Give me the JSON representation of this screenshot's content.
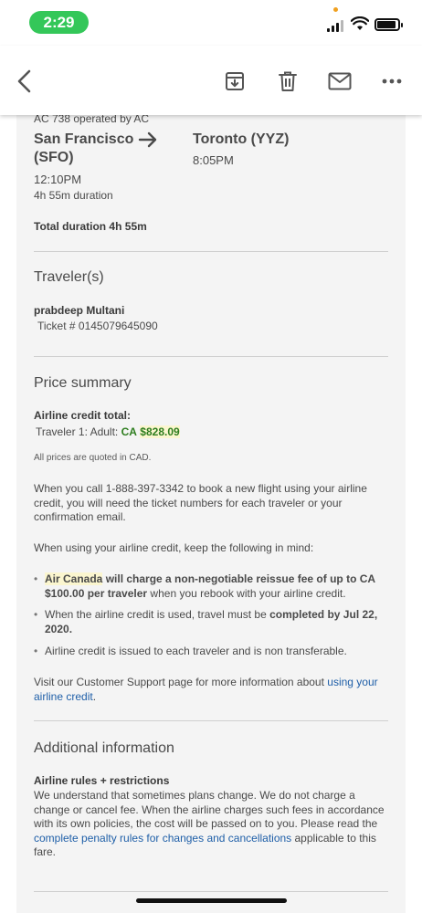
{
  "status": {
    "time": "2:29"
  },
  "toolbar": {
    "back_icon": "chevron-left-icon",
    "archive_icon": "archive-icon",
    "trash_icon": "trash-icon",
    "mail_icon": "mail-icon",
    "more_icon": "more-icon"
  },
  "flight": {
    "operated_by": "AC 738 operated by AC",
    "origin_line1": "San Francisco",
    "origin_line2": "(SFO)",
    "destination": "Toronto (YYZ)",
    "depart_time": "12:10PM",
    "arrive_time": "8:05PM",
    "duration": "4h 55m duration",
    "total_duration": "Total duration 4h 55m"
  },
  "traveler": {
    "section_title": "Traveler(s)",
    "name": "prabdeep Multani",
    "ticket": "Ticket # 0145079645090"
  },
  "price": {
    "section_title": "Price summary",
    "credit_total_label": "Airline credit total:",
    "traveler_line_prefix": "Traveler 1: Adult:",
    "currency": "CA",
    "amount": "$828.09",
    "note": "All prices are quoted in CAD.",
    "call_info": "When you call 1-888-397-3342 to book a new flight using your airline credit, you will need the ticket numbers for each traveler or your confirmation email.",
    "keep_in_mind": "When using your airline credit, keep the following in mind:",
    "bullet1_airline": "Air Canada",
    "bullet1_bold": " will charge a non-negotiable reissue fee of up to CA $100.00 per traveler",
    "bullet1_rest": " when you rebook with your airline credit.",
    "bullet2_prefix": "When the airline credit is used, travel must be ",
    "bullet2_bold": "completed by Jul 22, 2020.",
    "bullet3": "Airline credit is issued to each traveler and is non transferable.",
    "support_prefix": "Visit our Customer Support page for more information about ",
    "support_link": "using your airline credit",
    "support_suffix": "."
  },
  "additional": {
    "section_title": "Additional information",
    "rules_title": "Airline rules + restrictions",
    "rules_text": "We understand that sometimes plans change. We do not charge a change or cancel fee. When the airline charges such fees in accordance with its own policies, the cost will be passed on to you. Please read the ",
    "rules_link": "complete penalty rules for changes and cancellations",
    "rules_suffix": " applicable to this fare."
  }
}
